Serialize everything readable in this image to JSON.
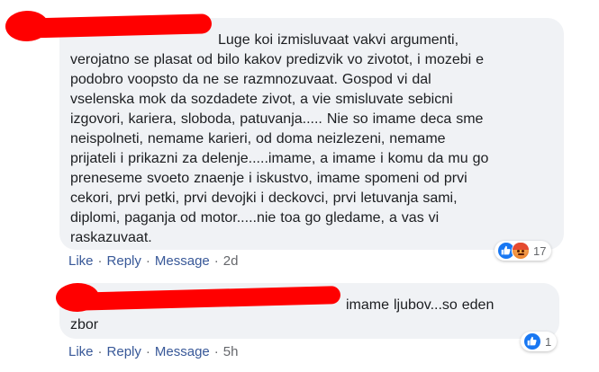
{
  "comment1": {
    "text": "Luge koi izmisluvaat vakvi argumenti,\nverojatno se plasat od bilo kakov predizvik vo zivotot, i mozebi e\npodobro voopsto da ne se razmnozuvaat. Gospod vi dal\nvselenska mok da sozdadete zivot, a vie smisluvate sebicni\nizgovori, kariera, sloboda, patuvanja..... Nie so imame deca sme\nneispolneti, nemame karieri, od doma neizlezeni, nemame\nprijateli i prikazni za delenje.....imame, a imame i komu da mu go\npreneseme svoeto znaenje i iskustvo, imame spomeni od prvi\ncekori, prvi petki, prvi devojki i deckovci, prvi letuvanja sami,\ndiplomi, paganja od motor.....nie toa go gledame, a vas vi\nraskazuvaat.",
    "actions": {
      "like": "Like",
      "reply": "Reply",
      "message": "Message",
      "time": "2d"
    },
    "reaction_count": "17"
  },
  "comment2": {
    "text": "imame ljubov...so eden\nzbor",
    "actions": {
      "like": "Like",
      "reply": "Reply",
      "message": "Message",
      "time": "5h"
    },
    "reaction_count": "1"
  },
  "separator": "·",
  "icons": {
    "like": "like-icon",
    "angry": "angry-icon"
  },
  "colors": {
    "link": "#385898",
    "bubble": "#f0f2f5",
    "redaction": "#ff0000",
    "like_blue": "#1877f2"
  }
}
